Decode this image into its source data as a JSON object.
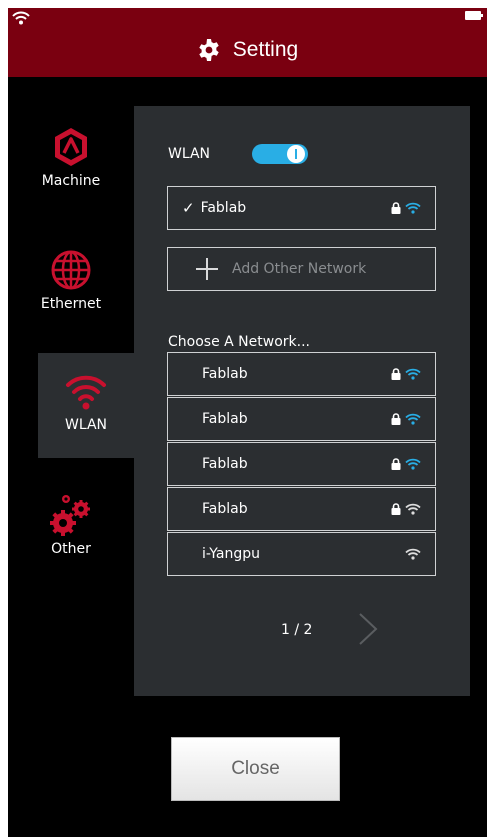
{
  "header": {
    "title": "Setting"
  },
  "sidebar": {
    "items": [
      {
        "label": "Machine",
        "icon": "machine-icon"
      },
      {
        "label": "Ethernet",
        "icon": "globe-icon"
      },
      {
        "label": "WLAN",
        "icon": "wifi-icon",
        "active": true
      },
      {
        "label": "Other",
        "icon": "gears-icon"
      }
    ]
  },
  "panel": {
    "wlan_label": "WLAN",
    "wlan_enabled": true,
    "connected_network": "Fablab",
    "add_network_label": "Add Other Network",
    "choose_label": "Choose A Network...",
    "networks": [
      {
        "name": "Fablab",
        "locked": true
      },
      {
        "name": "Fablab",
        "locked": true
      },
      {
        "name": "Fablab",
        "locked": true
      },
      {
        "name": "Fablab",
        "locked": true
      },
      {
        "name": "i-Yangpu",
        "locked": false
      }
    ],
    "pager": {
      "text": "1 / 2"
    }
  },
  "close_label": "Close",
  "colors": {
    "header": "#7a0010",
    "accent_red": "#c8102e",
    "toggle": "#29aee5",
    "wifi_signal": "#29aee5",
    "panel": "#2b2e31"
  }
}
